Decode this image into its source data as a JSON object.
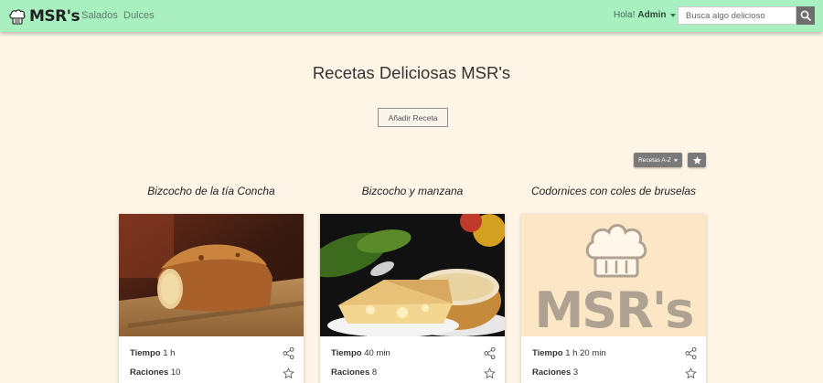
{
  "navbar": {
    "brand": "MSR's",
    "links": [
      "Salados",
      "Dulces"
    ],
    "greeting": "Hola!",
    "username": "Admin",
    "search_placeholder": "Busca algo delicioso"
  },
  "main": {
    "title": "Recetas Deliciosas MSR's",
    "add_button": "Añadir Receta",
    "sort_button": "Recetas A-Z"
  },
  "recipes": [
    {
      "title": "Bizcocho de la tía Concha",
      "time_label": "Tiempo",
      "time": "1 h",
      "servings_label": "Raciones",
      "servings": "10",
      "image": "loaf-cake-photo"
    },
    {
      "title": "Bizcocho y manzana",
      "time_label": "Tiempo",
      "time": "40 min",
      "servings_label": "Raciones",
      "servings": "8",
      "image": "apple-cake-photo"
    },
    {
      "title": "Codornices con coles de bruselas",
      "time_label": "Tiempo",
      "time": "1 h 20 min",
      "servings_label": "Raciones",
      "servings": "3",
      "image": "msr-placeholder"
    }
  ],
  "placeholder_logo_text": "MSR's",
  "colors": {
    "navbar": "#a8f0c0",
    "background": "#fff5e6",
    "placeholder": "#fbe6c6"
  }
}
